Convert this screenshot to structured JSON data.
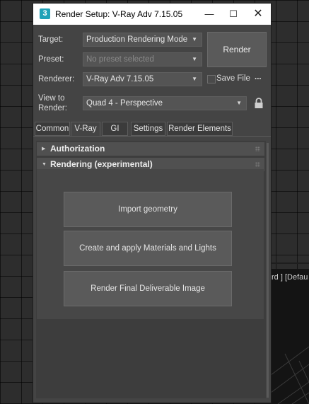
{
  "window": {
    "title": "Render Setup: V-Ray Adv 7.15.05",
    "app_icon_glyph": "3",
    "minimize_glyph": "—",
    "maximize_glyph": "☐",
    "close_glyph": "✕"
  },
  "form": {
    "target_label": "Target:",
    "target_value": "Production Rendering Mode",
    "preset_label": "Preset:",
    "preset_value": "No preset selected",
    "renderer_label": "Renderer:",
    "renderer_value": "V-Ray Adv 7.15.05",
    "view_label_line1": "View to",
    "view_label_line2": "Render:",
    "view_value": "Quad 4 - Perspective",
    "render_button": "Render",
    "save_file_label": "Save File",
    "save_file_checked": false,
    "more_glyph": "...",
    "dropdown_arrow": "▼"
  },
  "tabs": [
    "Common",
    "V-Ray",
    "GI",
    "Settings",
    "Render Elements"
  ],
  "active_tab": "V-Ray",
  "rollouts": {
    "authorization": {
      "title": "Authorization",
      "collapsed": true,
      "glyph": "▶"
    },
    "rendering": {
      "title": "Rendering (experimental)",
      "collapsed": false,
      "glyph": "▼"
    }
  },
  "actions": {
    "import": "Import geometry",
    "materials": "Create and apply Materials and Lights",
    "render_final": "Render Final Deliverable Image"
  },
  "viewport": {
    "label": "rd ] [Defau"
  },
  "icons": {
    "app": "3ds-max-icon",
    "lock": "lock-icon",
    "dropdown": "chevron-down-icon",
    "rollout_collapsed": "triangle-right-icon",
    "rollout_expanded": "triangle-down-icon"
  },
  "colors": {
    "window_bg": "#444444",
    "titlebar_bg": "#ffffff",
    "app_icon": "#1fa2b8"
  }
}
